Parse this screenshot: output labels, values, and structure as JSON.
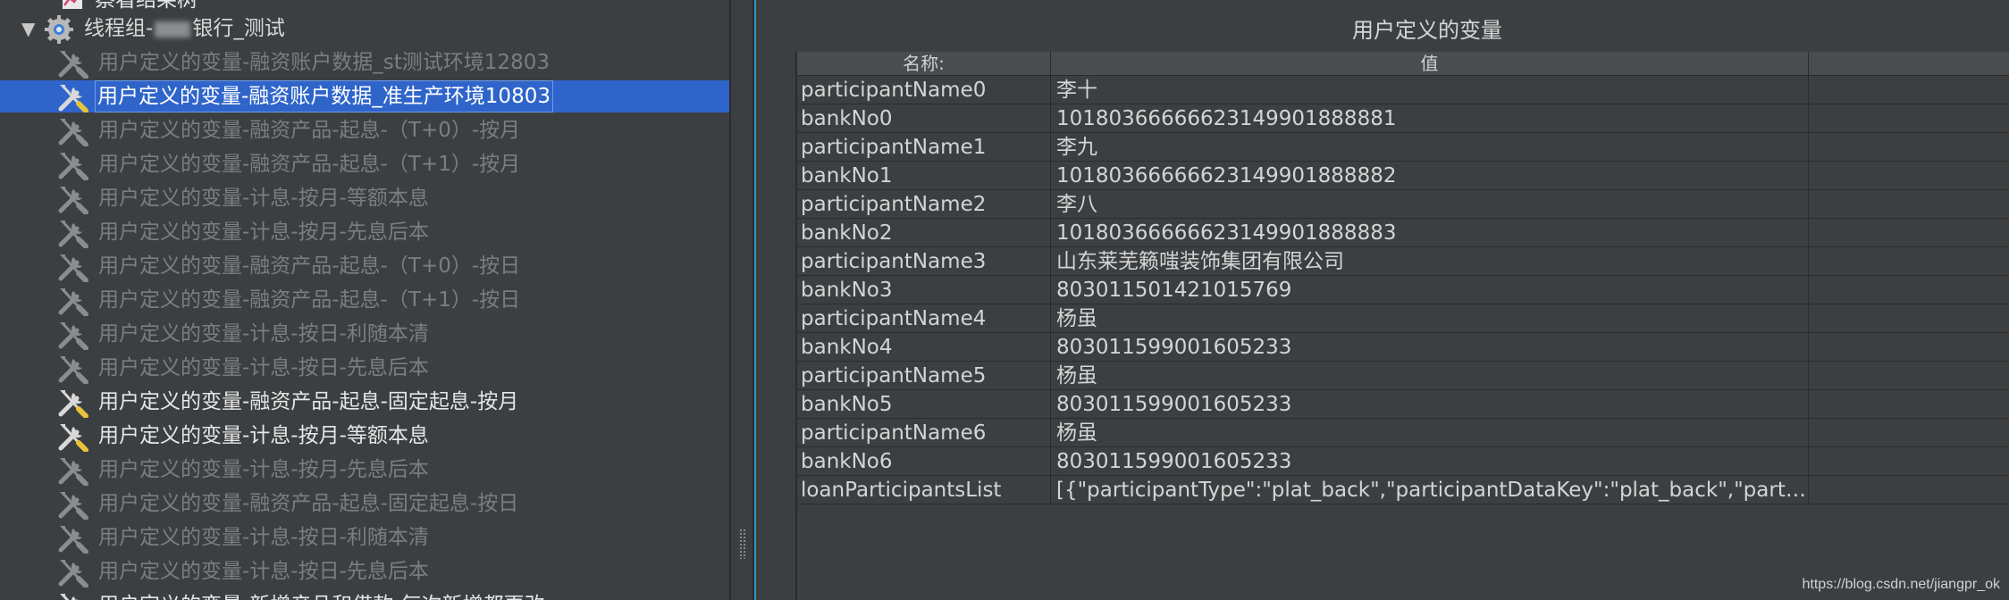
{
  "tree": {
    "top_partial_label": "察看结果树",
    "group": {
      "label_prefix": "线程组-",
      "label_suffix": "银行_测试"
    },
    "items": [
      {
        "label": "用户定义的变量-融资账户数据_st测试环境12803",
        "state": "disabled"
      },
      {
        "label": "用户定义的变量-融资账户数据_准生产环境10803",
        "state": "selected"
      },
      {
        "label": "用户定义的变量-融资产品-起息-（T+0）-按月",
        "state": "disabled"
      },
      {
        "label": "用户定义的变量-融资产品-起息-（T+1）-按月",
        "state": "disabled"
      },
      {
        "label": "用户定义的变量-计息-按月-等额本息",
        "state": "disabled"
      },
      {
        "label": "用户定义的变量-计息-按月-先息后本",
        "state": "disabled"
      },
      {
        "label": "用户定义的变量-融资产品-起息-（T+0）-按日",
        "state": "disabled"
      },
      {
        "label": "用户定义的变量-融资产品-起息-（T+1）-按日",
        "state": "disabled"
      },
      {
        "label": "用户定义的变量-计息-按日-利随本清",
        "state": "disabled"
      },
      {
        "label": "用户定义的变量-计息-按日-先息后本",
        "state": "disabled"
      },
      {
        "label": "用户定义的变量-融资产品-起息-固定起息-按月",
        "state": "enabled"
      },
      {
        "label": "用户定义的变量-计息-按月-等额本息",
        "state": "enabled"
      },
      {
        "label": "用户定义的变量-计息-按月-先息后本",
        "state": "disabled"
      },
      {
        "label": "用户定义的变量-融资产品-起息-固定起息-按日",
        "state": "disabled"
      },
      {
        "label": "用户定义的变量-计息-按日-利随本清",
        "state": "disabled"
      },
      {
        "label": "用户定义的变量-计息-按日-先息后本",
        "state": "disabled"
      },
      {
        "label": "用户定义的变量-新增产品和借款-每次新增都更改",
        "state": "enabled"
      }
    ]
  },
  "panel": {
    "title": "用户定义的变量",
    "columns": [
      "名称:",
      "值",
      ""
    ],
    "rows": [
      {
        "name": "participantName0",
        "value": "李十"
      },
      {
        "name": "bankNo0",
        "value": "10180366666623149901888881"
      },
      {
        "name": "participantName1",
        "value": "李九"
      },
      {
        "name": "bankNo1",
        "value": "10180366666623149901888882"
      },
      {
        "name": "participantName2",
        "value": "李八"
      },
      {
        "name": "bankNo2",
        "value": "10180366666623149901888883"
      },
      {
        "name": "participantName3",
        "value": "山东莱芜籁嗤装饰集团有限公司"
      },
      {
        "name": "bankNo3",
        "value": "803011501421015769"
      },
      {
        "name": "participantName4",
        "value": "杨虽"
      },
      {
        "name": "bankNo4",
        "value": "803011599001605233"
      },
      {
        "name": "participantName5",
        "value": "杨虽"
      },
      {
        "name": "bankNo5",
        "value": "803011599001605233"
      },
      {
        "name": "participantName6",
        "value": "杨虽"
      },
      {
        "name": "bankNo6",
        "value": "803011599001605233"
      },
      {
        "name": "loanParticipantsList",
        "value": "[{\"participantType\":\"plat_back\",\"participantDataKey\":\"plat_back\",\"partici..."
      }
    ]
  },
  "watermark": "https://blog.csdn.net/jiangpr_ok",
  "colors": {
    "background": "#3c3f41",
    "selection": "#2f65ca",
    "accent_edge": "#3592c4"
  },
  "icons": {
    "group": "gear-icon",
    "config_element": "wrench-screwdriver-icon",
    "expand": "triangle-down-icon",
    "listener": "chart-icon"
  }
}
